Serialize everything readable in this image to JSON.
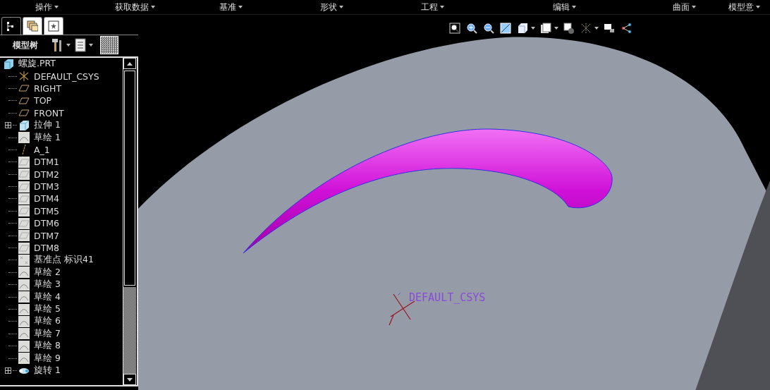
{
  "menu_bar": {
    "items": [
      "操作",
      "获取数据",
      "基准",
      "形状",
      "工程",
      "编辑",
      "曲面",
      "模型意"
    ]
  },
  "navigator": {
    "tabs": [
      {
        "kind": "tree",
        "selected": true
      },
      {
        "kind": "layers",
        "selected": false
      },
      {
        "kind": "favorites",
        "selected": false
      }
    ],
    "title": "模型树",
    "tree": {
      "label": "螺旋.PRT",
      "children": [
        {
          "kind": "csys",
          "label": "DEFAULT_CSYS",
          "collapsed": false
        },
        {
          "kind": "plane",
          "label": "RIGHT",
          "collapsed": false
        },
        {
          "kind": "plane",
          "label": "TOP",
          "collapsed": false
        },
        {
          "kind": "plane",
          "label": "FRONT",
          "collapsed": false
        },
        {
          "kind": "solid",
          "label": "拉伸 1",
          "collapsed": true
        },
        {
          "kind": "sketch",
          "label": "草绘 1",
          "collapsed": false
        },
        {
          "kind": "axis",
          "label": "A_1",
          "collapsed": false
        },
        {
          "kind": "datum",
          "label": "DTM1",
          "collapsed": false
        },
        {
          "kind": "datum",
          "label": "DTM2",
          "collapsed": false
        },
        {
          "kind": "datum",
          "label": "DTM3",
          "collapsed": false
        },
        {
          "kind": "datum",
          "label": "DTM4",
          "collapsed": false
        },
        {
          "kind": "datum",
          "label": "DTM5",
          "collapsed": false
        },
        {
          "kind": "datum",
          "label": "DTM6",
          "collapsed": false
        },
        {
          "kind": "datum",
          "label": "DTM7",
          "collapsed": false
        },
        {
          "kind": "datum",
          "label": "DTM8",
          "collapsed": false
        },
        {
          "kind": "point",
          "label": "基准点 标识41",
          "collapsed": false
        },
        {
          "kind": "sketch",
          "label": "草绘 2",
          "collapsed": false
        },
        {
          "kind": "sketch",
          "label": "草绘 3",
          "collapsed": false
        },
        {
          "kind": "sketch",
          "label": "草绘 4",
          "collapsed": false
        },
        {
          "kind": "sketch",
          "label": "草绘 5",
          "collapsed": false
        },
        {
          "kind": "sketch",
          "label": "草绘 6",
          "collapsed": false
        },
        {
          "kind": "sketch",
          "label": "草绘 7",
          "collapsed": false
        },
        {
          "kind": "sketch",
          "label": "草绘 8",
          "collapsed": false
        },
        {
          "kind": "sketch",
          "label": "草绘 9",
          "collapsed": false
        },
        {
          "kind": "revolve",
          "label": "旋转 1",
          "collapsed": true
        }
      ]
    }
  },
  "viewport": {
    "csys_label": "DEFAULT_CSYS"
  }
}
